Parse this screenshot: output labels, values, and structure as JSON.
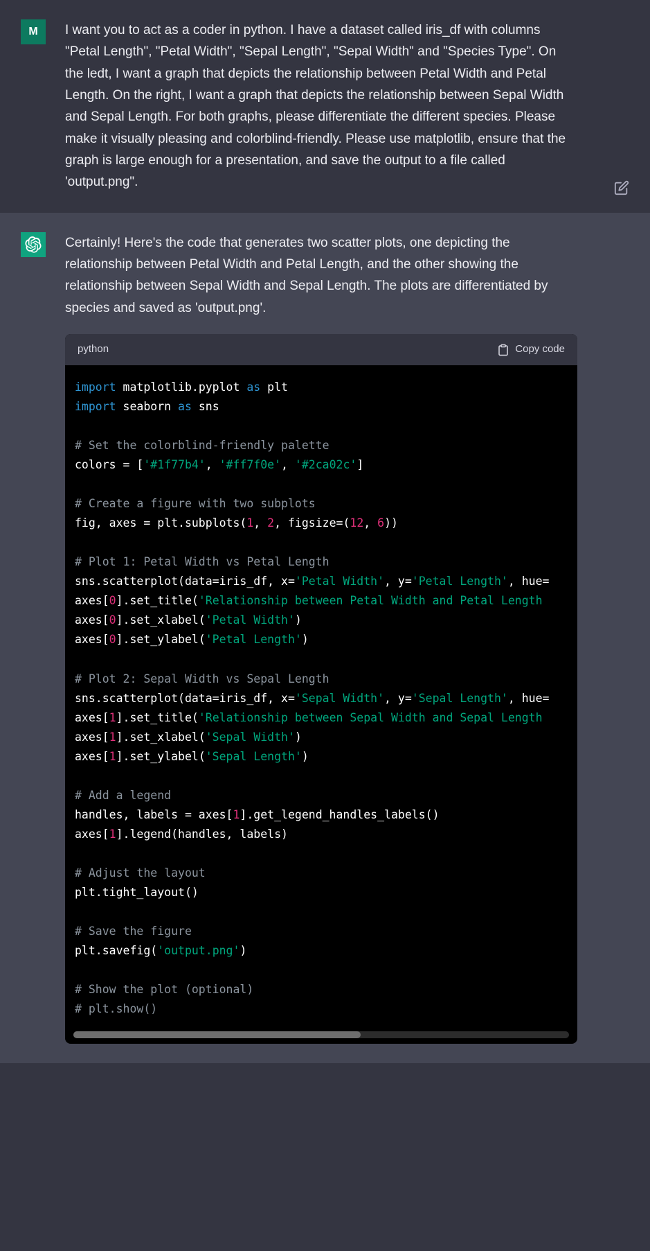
{
  "user": {
    "avatar_letter": "M",
    "message": "I want you to act as a coder in python. I have a dataset called iris_df with columns \"Petal Length\", \"Petal Width\", \"Sepal Length\", \"Sepal Width\" and \"Species Type\". On the ledt, I want a graph that depicts the relationship between Petal Width and Petal Length. On the right, I want a graph that depicts the relationship between Sepal Width and Sepal Length. For both graphs, please differentiate the different species. Please make it visually pleasing and colorblind-friendly. Please use matplotlib, ensure that the graph is large enough for a presentation, and save the output to a file called 'output.png\"."
  },
  "assistant": {
    "intro": "Certainly! Here's the code that generates two scatter plots, one depicting the relationship between Petal Width and Petal Length, and the other showing the relationship between Sepal Width and Sepal Length. The plots are differentiated by species and saved as 'output.png'.",
    "code_lang": "python",
    "copy_label": "Copy code",
    "code": {
      "l1_kw": "import",
      "l1_mod": " matplotlib.pyplot ",
      "l1_as": "as",
      "l1_alias": " plt",
      "l2_kw": "import",
      "l2_mod": " seaborn ",
      "l2_as": "as",
      "l2_alias": " sns",
      "c1": "# Set the colorblind-friendly palette",
      "l3a": "colors = [",
      "l3s1": "'#1f77b4'",
      "l3b": ", ",
      "l3s2": "'#ff7f0e'",
      "l3c": ", ",
      "l3s3": "'#2ca02c'",
      "l3d": "]",
      "c2": "# Create a figure with two subplots",
      "l4a": "fig, axes = plt.subplots(",
      "l4n1": "1",
      "l4b": ", ",
      "l4n2": "2",
      "l4c": ", figsize=(",
      "l4n3": "12",
      "l4d": ", ",
      "l4n4": "6",
      "l4e": "))",
      "c3": "# Plot 1: Petal Width vs Petal Length",
      "l5a": "sns.scatterplot(data=iris_df, x=",
      "l5s1": "'Petal Width'",
      "l5b": ", y=",
      "l5s2": "'Petal Length'",
      "l5c": ", hue=",
      "l6a": "axes[",
      "l6n": "0",
      "l6b": "].set_title(",
      "l6s": "'Relationship between Petal Width and Petal Length",
      "l7a": "axes[",
      "l7n": "0",
      "l7b": "].set_xlabel(",
      "l7s": "'Petal Width'",
      "l7c": ")",
      "l8a": "axes[",
      "l8n": "0",
      "l8b": "].set_ylabel(",
      "l8s": "'Petal Length'",
      "l8c": ")",
      "c4": "# Plot 2: Sepal Width vs Sepal Length",
      "l9a": "sns.scatterplot(data=iris_df, x=",
      "l9s1": "'Sepal Width'",
      "l9b": ", y=",
      "l9s2": "'Sepal Length'",
      "l9c": ", hue=",
      "l10a": "axes[",
      "l10n": "1",
      "l10b": "].set_title(",
      "l10s": "'Relationship between Sepal Width and Sepal Length",
      "l11a": "axes[",
      "l11n": "1",
      "l11b": "].set_xlabel(",
      "l11s": "'Sepal Width'",
      "l11c": ")",
      "l12a": "axes[",
      "l12n": "1",
      "l12b": "].set_ylabel(",
      "l12s": "'Sepal Length'",
      "l12c": ")",
      "c5": "# Add a legend",
      "l13a": "handles, labels = axes[",
      "l13n": "1",
      "l13b": "].get_legend_handles_labels()",
      "l14a": "axes[",
      "l14n": "1",
      "l14b": "].legend(handles, labels)",
      "c6": "# Adjust the layout",
      "l15": "plt.tight_layout()",
      "c7": "# Save the figure",
      "l16a": "plt.savefig(",
      "l16s": "'output.png'",
      "l16b": ")",
      "c8": "# Show the plot (optional)",
      "c9": "# plt.show()"
    }
  }
}
